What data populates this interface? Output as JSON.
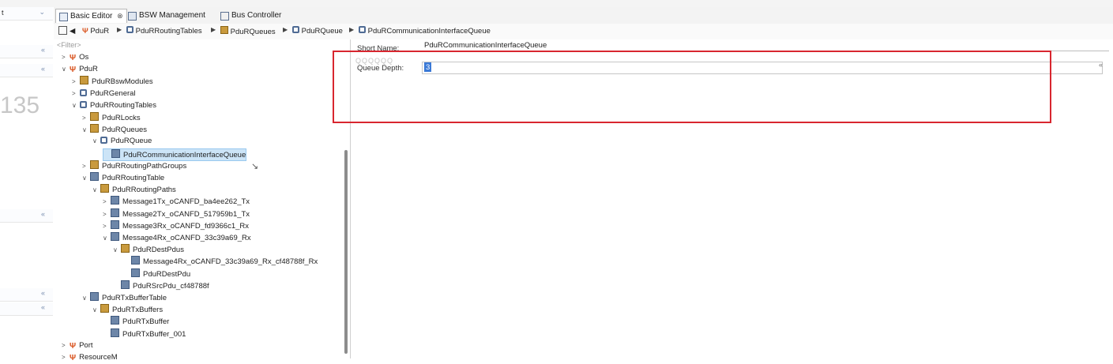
{
  "tabs": [
    {
      "label": "Basic Editor",
      "close": "⊗",
      "active": true
    },
    {
      "label": "BSW Management",
      "active": false
    },
    {
      "label": "Bus Controller",
      "active": false
    }
  ],
  "breadcrumb": [
    "PduR",
    "PduRRoutingTables",
    "PduRQueues",
    "PduRQueue",
    "PduRCommunicationInterfaceQueue"
  ],
  "tree": {
    "filter_placeholder": "<Filter>",
    "nodes": [
      {
        "label": "Os",
        "toggle": ">",
        "icon": "module",
        "depth": 0
      },
      {
        "label": "PduR",
        "toggle": "∨",
        "icon": "module",
        "depth": 0
      },
      {
        "label": "PduRBswModules",
        "toggle": ">",
        "icon": "folder",
        "depth": 1
      },
      {
        "label": "PduRGeneral",
        "toggle": ">",
        "icon": "container",
        "depth": 1
      },
      {
        "label": "PduRRoutingTables",
        "toggle": "∨",
        "icon": "container",
        "depth": 1
      },
      {
        "label": "PduRLocks",
        "toggle": ">",
        "icon": "folder",
        "depth": 2
      },
      {
        "label": "PduRQueues",
        "toggle": "∨",
        "icon": "folder",
        "depth": 2
      },
      {
        "label": "PduRQueue",
        "toggle": "∨",
        "icon": "container",
        "depth": 3
      },
      {
        "label": "PduRCommunicationInterfaceQueue",
        "toggle": "",
        "icon": "param",
        "depth": 4,
        "selected": true
      },
      {
        "label": "PduRRoutingPathGroups",
        "toggle": ">",
        "icon": "folder",
        "depth": 2
      },
      {
        "label": "PduRRoutingTable",
        "toggle": "∨",
        "icon": "param",
        "depth": 2
      },
      {
        "label": "PduRRoutingPaths",
        "toggle": "∨",
        "icon": "folder",
        "depth": 3
      },
      {
        "label": "Message1Tx_oCANFD_ba4ee262_Tx",
        "toggle": ">",
        "icon": "param",
        "depth": 4
      },
      {
        "label": "Message2Tx_oCANFD_517959b1_Tx",
        "toggle": ">",
        "icon": "param",
        "depth": 4
      },
      {
        "label": "Message3Rx_oCANFD_fd9366c1_Rx",
        "toggle": ">",
        "icon": "param",
        "depth": 4
      },
      {
        "label": "Message4Rx_oCANFD_33c39a69_Rx",
        "toggle": "∨",
        "icon": "param",
        "depth": 4
      },
      {
        "label": "PduRDestPdus",
        "toggle": "∨",
        "icon": "folder",
        "depth": 5
      },
      {
        "label": "Message4Rx_oCANFD_33c39a69_Rx_cf48788f_Rx",
        "toggle": "",
        "icon": "param",
        "depth": 6
      },
      {
        "label": "PduRDestPdu",
        "toggle": "",
        "icon": "param",
        "depth": 6
      },
      {
        "label": "PduRSrcPdu_cf48788f",
        "toggle": "",
        "icon": "param",
        "depth": 5
      },
      {
        "label": "PduRTxBufferTable",
        "toggle": "∨",
        "icon": "param",
        "depth": 2
      },
      {
        "label": "PduRTxBuffers",
        "toggle": "∨",
        "icon": "folder",
        "depth": 3
      },
      {
        "label": "PduRTxBuffer",
        "toggle": "",
        "icon": "param",
        "depth": 4
      },
      {
        "label": "PduRTxBuffer_001",
        "toggle": "",
        "icon": "param",
        "depth": 4
      },
      {
        "label": "Port",
        "toggle": ">",
        "icon": "module",
        "depth": 0
      },
      {
        "label": "ResourceM",
        "toggle": ">",
        "icon": "module",
        "depth": 0
      }
    ]
  },
  "editor": {
    "short_name_label": "Short Name:",
    "short_name_value": "PduRCommunicationInterfaceQueue",
    "ghost_text": "QQQQQQ",
    "queue_depth_label": "Queue Depth:",
    "queue_depth_value": "3"
  },
  "left_panel": {
    "big_number": "135",
    "rows": [
      "t",
      "",
      "",
      "",
      "",
      "",
      "",
      ""
    ]
  },
  "colors": {
    "highlight": "#d8262f",
    "selection": "#cce4f7",
    "value_highlight": "#3a79d6"
  }
}
